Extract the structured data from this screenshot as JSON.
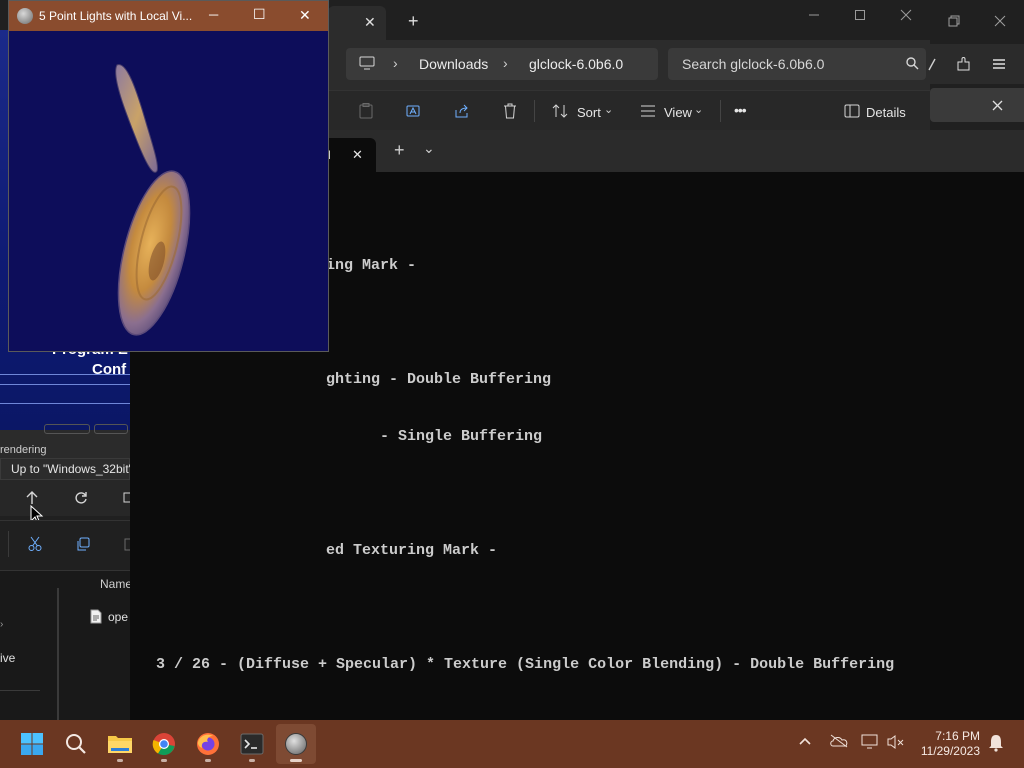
{
  "demo_window": {
    "title": "5 Point Lights with Local Vi...",
    "minimize": "─",
    "maximize": "☐",
    "close": "✕"
  },
  "back_window": {
    "e_letter": "E",
    "program_text": "Program E",
    "conf_text": "Conf",
    "rendering_text": "rendering",
    "tooltip": "Up to \"Windows_32bit\"",
    "list_header": "Name",
    "list_item": "ope",
    "nav_item": "ive"
  },
  "explorer": {
    "new_tab": "+",
    "tab_close": "✕",
    "breadcrumb": [
      "Downloads",
      "glclock-6.0b6.0"
    ],
    "search_placeholder": "Search glclock-6.0b6.0",
    "sort_label": "Sort",
    "view_label": "View",
    "more_label": "•••",
    "details_label": "Details"
  },
  "terminal": {
    "tab_title": "cl",
    "tab_close": "✕",
    "new_tab": "+",
    "lines": [
      "ing Mark -",
      "",
      "ghting - Double Buffering",
      "      - Single Buffering",
      "",
      "ed Texturing Mark -",
      "",
      "3 / 26 - (Diffuse + Specular) * Texture (Single Color Blending) - Double Buffering"
    ]
  },
  "taskbar": {
    "time": "7:16 PM",
    "date": "11/29/2023"
  },
  "colors": {
    "taskbar": "#6b3722",
    "demo_titlebar": "#8a4c2e",
    "demo_canvas": "#0d0d5a",
    "terminal_bg": "#0c0c0c"
  }
}
